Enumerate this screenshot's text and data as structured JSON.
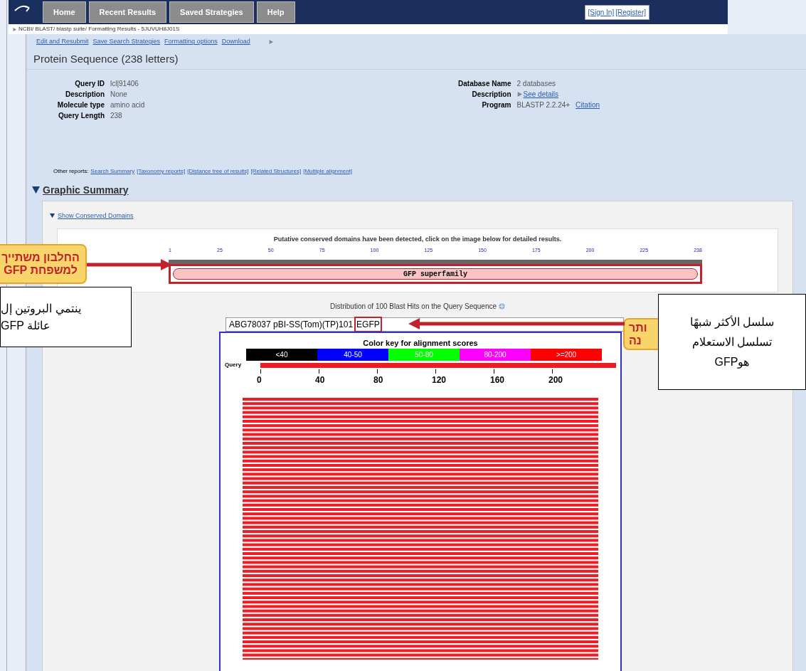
{
  "nav": {
    "tabs": [
      "Home",
      "Recent Results",
      "Saved Strategies",
      "Help"
    ],
    "account_links": [
      "[Sign In]",
      "[Register]"
    ]
  },
  "breadcrumb": "NCBI/ BLAST/ blastp suite/ Formatting Results - 5JUVUH8J01S",
  "actions": [
    "Edit and Resubmit",
    "Save Search Strategies",
    "Formatting options",
    "Download"
  ],
  "title": "Protein Sequence (238 letters)",
  "query_info": [
    {
      "label": "Query ID",
      "value": "lcl|91406"
    },
    {
      "label": "Description",
      "value": "None"
    },
    {
      "label": "Molecule type",
      "value": "amino acid"
    },
    {
      "label": "Query Length",
      "value": "238"
    }
  ],
  "database_info": [
    {
      "label": "Database Name",
      "value": "2 databases"
    },
    {
      "label": "Description",
      "value": "See details",
      "link": true
    },
    {
      "label": "Program",
      "value": "BLASTP 2.2.24+",
      "extra_link": "Citation"
    }
  ],
  "other_reports": {
    "label": "Other reports:",
    "links": [
      "Search Summary",
      "[Taxonomy reports]",
      "[Distance tree of results]",
      "[Related Structures]",
      "[Multiple alignment]"
    ]
  },
  "graphic_summary": {
    "title": "Graphic Summary",
    "expanded": true,
    "conserved": {
      "toggle": "Show Conserved Domains",
      "expanded": true,
      "note": "Putative conserved domains have been detected, click on the image below for detailed results.",
      "ruler": [
        "1",
        "25",
        "50",
        "75",
        "100",
        "125",
        "150",
        "175",
        "200",
        "225",
        "238"
      ],
      "domain": "GFP superfamily"
    },
    "distribution": {
      "title": "Distribution of 100 Blast Hits on the Query Sequence",
      "hit": "ABG78037 pBI-SS(Tom)(TP)101",
      "hit_highlight": "EGFP",
      "color_key": {
        "title": "Color key for alignment scores",
        "bins": [
          {
            "label": "<40",
            "color": "#000000"
          },
          {
            "label": "40-50",
            "color": "#0000ff"
          },
          {
            "label": "50-80",
            "color": "#00ff00"
          },
          {
            "label": "80-200",
            "color": "#ff00ff"
          },
          {
            "label": ">=200",
            "color": "#ff0000"
          }
        ]
      },
      "query_label": "Query",
      "axis": [
        "0",
        "40",
        "80",
        "120",
        "160",
        "200"
      ]
    }
  },
  "annotations": {
    "left_callout": [
      "החלבון משתייך",
      "למשפחת GFP"
    ],
    "left_box": [
      "ينتمي البروتين إل",
      "عائلة GFP"
    ],
    "right_callout": [
      "ותר",
      "נה"
    ],
    "right_box": [
      "سلسل الأكثر شبهًا",
      "تسلسل الاستعلام",
      "هوGFP"
    ]
  }
}
